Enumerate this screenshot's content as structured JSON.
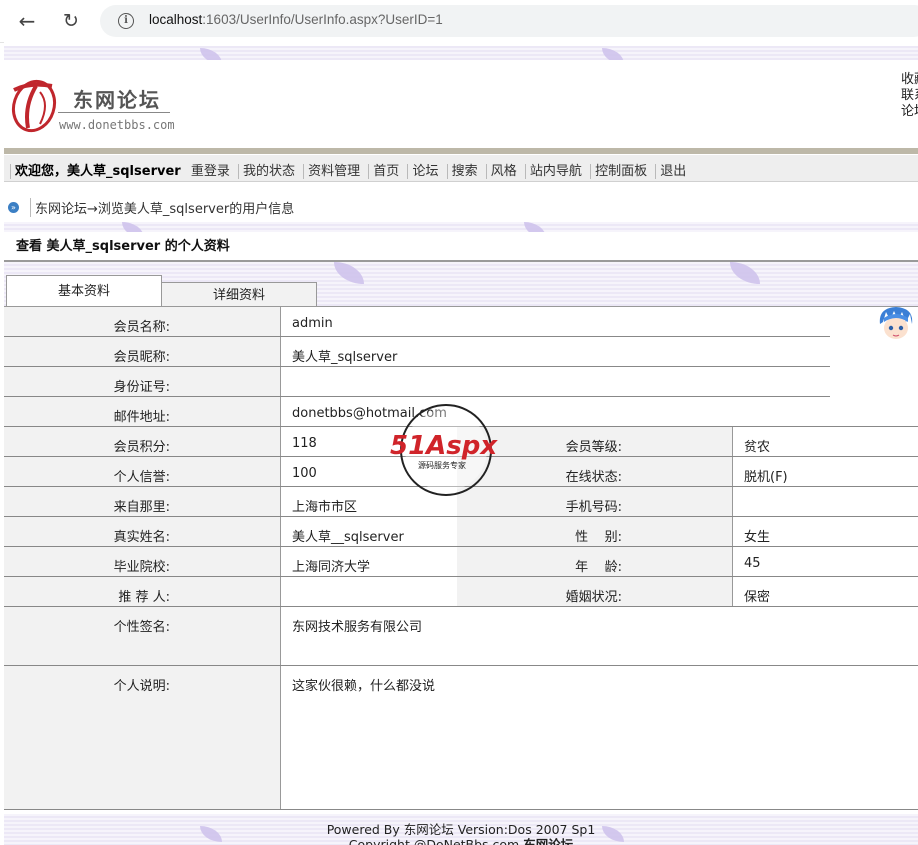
{
  "browser": {
    "url_host": "localhost",
    "url_rest": ":1603/UserInfo/UserInfo.aspx?UserID=1"
  },
  "header": {
    "logo_title": "东网论坛",
    "logo_url": "www.donetbbs.com",
    "quick_links": [
      "收藏",
      "联系",
      "论坛"
    ]
  },
  "menu": {
    "welcome": "欢迎您，",
    "user": "美人草_sqlserver",
    "items": [
      "重登录",
      "我的状态",
      "资料管理",
      "首页",
      "论坛",
      "搜索",
      "风格",
      "站内导航",
      "控制面板",
      "退出"
    ]
  },
  "breadcrumb": {
    "forum": "东网论坛",
    "rest": "→浏览美人草_sqlserver的用户信息"
  },
  "title": "查看 美人草_sqlserver 的个人资料",
  "tabs": [
    "基本资料",
    "详细资料"
  ],
  "profile": {
    "labels": {
      "name": "会员名称:",
      "nick": "会员昵称:",
      "idcard": "身份证号:",
      "email": "邮件地址:",
      "points": "会员积分:",
      "level": "会员等级:",
      "credit": "个人信誉:",
      "online": "在线状态:",
      "from": "来自那里:",
      "mobile": "手机号码:",
      "realname": "真实姓名:",
      "gender": "性    别:",
      "school": "毕业院校:",
      "age": "年    龄:",
      "referrer": "推 荐 人:",
      "marital": "婚姻状况:",
      "signature": "个性签名:",
      "about": "个人说明:"
    },
    "values": {
      "name": "admin",
      "nick": "美人草_sqlserver",
      "idcard": "",
      "email": "donetbbs@hotmail.com",
      "points": "118",
      "level": "贫农",
      "credit": "100",
      "online": "脱机(F)",
      "from": "上海市市区",
      "mobile": "",
      "realname": "美人草__sqlserver",
      "gender": "女生",
      "school": "上海同济大学",
      "age": "45",
      "referrer": "",
      "marital": "保密",
      "signature": "东网技术服务有限公司",
      "about": "这家伙很赖，什么都没说"
    }
  },
  "watermark": {
    "brand": "51Aspx",
    "tagline": "源码服务专家"
  },
  "footer": {
    "line1_prefix": "Powered By ",
    "line1_brand": "东网论坛",
    "line1_suffix": " Version:Dos 2007 Sp1",
    "line2_prefix": "Copyright @DoNetBbs.com ",
    "line2_brand": "东网论坛"
  },
  "colors": {
    "band": "#ece8f6",
    "label_bg": "#f2f2f2",
    "logo_red": "#c0262c",
    "watermark_red": "#d0242a"
  }
}
